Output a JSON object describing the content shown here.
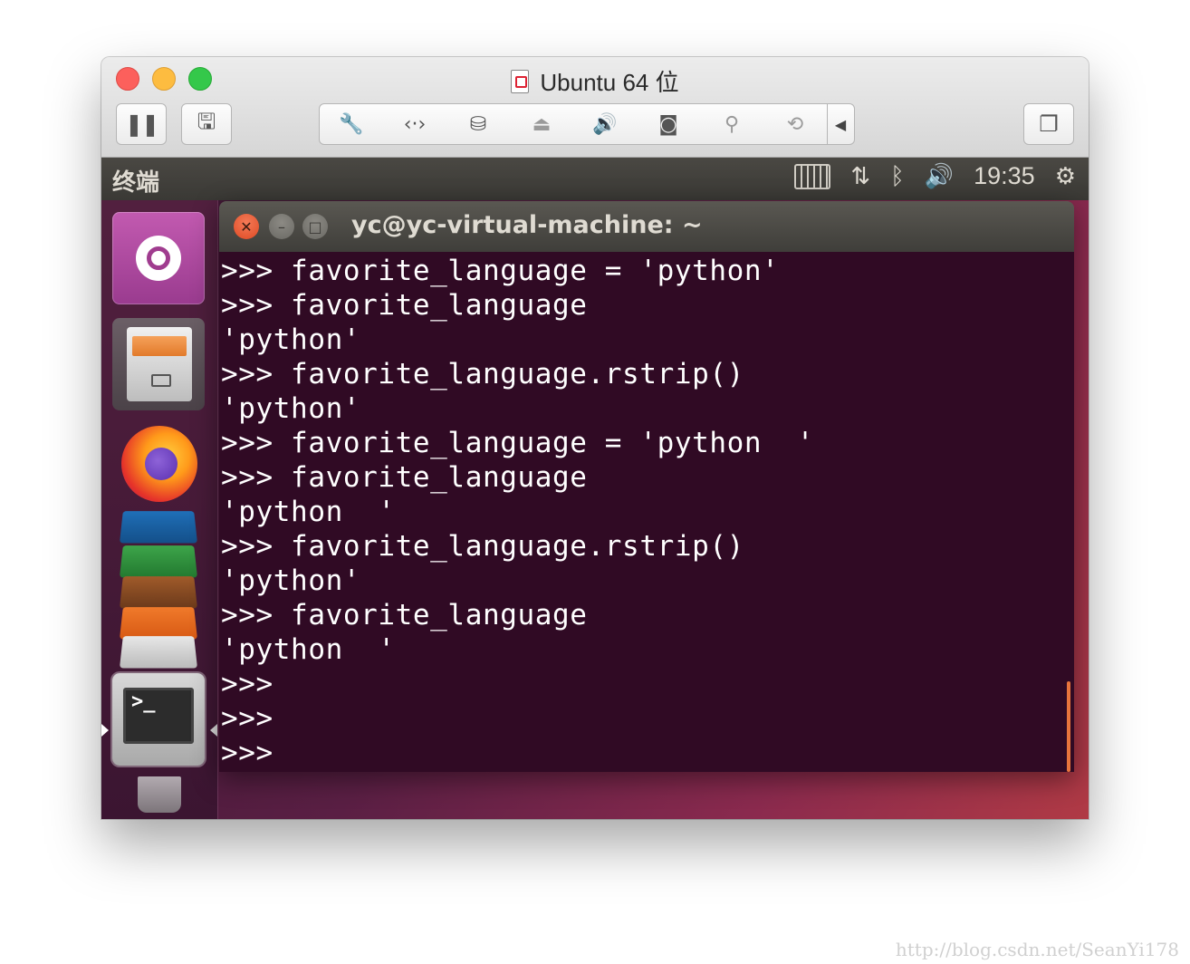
{
  "vm_window": {
    "title": "Ubuntu 64 位",
    "toolbar": {
      "pause_icon": "pause-icon",
      "snapshot_icon": "snapshot-icon",
      "group_icons": [
        "wrench-icon",
        "network-icon",
        "hard-disk-icon",
        "cd-drive-icon",
        "sound-icon",
        "camera-icon",
        "usb-icon",
        "sharing-icon"
      ],
      "collapse_icon": "chevron-left-icon",
      "window_icon": "windows-icon"
    }
  },
  "ubuntu": {
    "panel": {
      "app_name": "终端",
      "clock": "19:35",
      "indicators": [
        "keyboard-icon",
        "network-transfer-icon",
        "bluetooth-icon",
        "volume-icon",
        "power-gear-icon"
      ]
    },
    "launcher": {
      "items": [
        "ubuntu-dash",
        "files",
        "firefox",
        "libreoffice-writer",
        "libreoffice-calc",
        "libreoffice-impress",
        "ubuntu-software",
        "amazon",
        "system-settings",
        "terminal",
        "trash"
      ]
    },
    "terminal": {
      "title": "yc@yc-virtual-machine: ~",
      "lines": [
        ">>> favorite_language = 'python'",
        ">>> favorite_language",
        "'python'",
        ">>> favorite_language.rstrip()",
        "'python'",
        ">>> favorite_language = 'python  '",
        ">>> favorite_language",
        "'python  '",
        ">>> favorite_language.rstrip()",
        "'python'",
        ">>> favorite_language",
        "'python  '",
        ">>>",
        ">>>",
        ">>>"
      ]
    }
  },
  "watermark": "http://blog.csdn.net/SeanYi178",
  "colors": {
    "terminal_bg": "#300a24",
    "panel_bg": "#3c3b37",
    "accent_orange": "#e8743c"
  }
}
